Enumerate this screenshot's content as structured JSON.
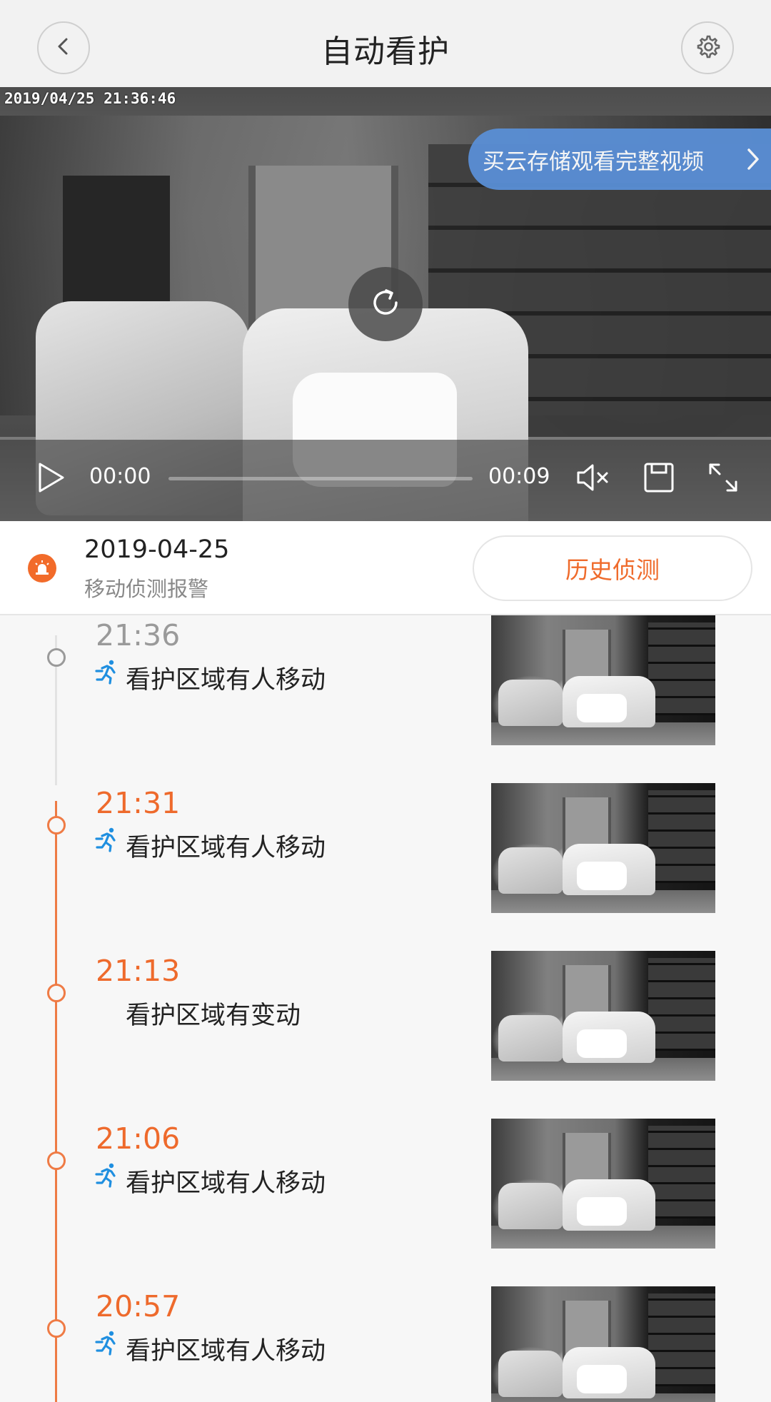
{
  "header": {
    "title": "自动看护",
    "back_icon": "chevron-left-icon",
    "settings_icon": "gear-icon"
  },
  "video": {
    "timestamp": "2019/04/25 21:36:46",
    "cloud_banner": "买云存储观看完整视频",
    "current_time": "00:00",
    "duration": "00:09",
    "progress": 0.0
  },
  "info": {
    "date": "2019-04-25",
    "subtitle": "移动侦测报警",
    "history_button": "历史侦测"
  },
  "events": [
    {
      "time": "21:36",
      "desc": "看护区域有人移动",
      "type": "person",
      "active": false
    },
    {
      "time": "21:31",
      "desc": "看护区域有人移动",
      "type": "person",
      "active": true
    },
    {
      "time": "21:13",
      "desc": "看护区域有变动",
      "type": "change",
      "active": true
    },
    {
      "time": "21:06",
      "desc": "看护区域有人移动",
      "type": "person",
      "active": true
    },
    {
      "time": "20:57",
      "desc": "看护区域有人移动",
      "type": "person",
      "active": true
    }
  ],
  "colors": {
    "accent": "#ef6b2c",
    "banner": "#5a8fd6",
    "run_icon": "#1f8fe0"
  }
}
